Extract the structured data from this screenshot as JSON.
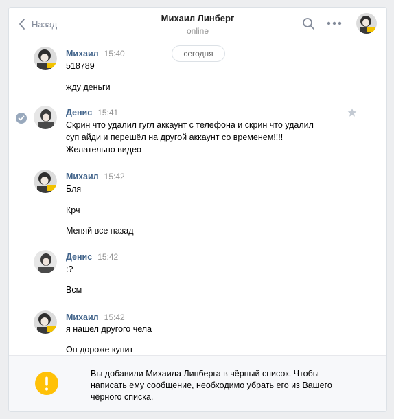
{
  "header": {
    "back_label": "Назад",
    "contact_name": "Михаил Линберг",
    "contact_status": "online"
  },
  "chat": {
    "date_label": "сегодня",
    "messages": [
      {
        "author": "Михаил",
        "time": "15:40",
        "lines": [
          "518789",
          "жду деньги"
        ]
      },
      {
        "author": "Денис",
        "time": "15:41",
        "lines": [
          "Скрин что удалил гугл аккаунт с телефона и скрин что удалил",
          "суп айди и перешёл на другой аккаунт со временем!!!!",
          "Желательно видео"
        ]
      },
      {
        "author": "Михаил",
        "time": "15:42",
        "lines": [
          "Бля",
          "Крч",
          "Меняй все назад"
        ]
      },
      {
        "author": "Денис",
        "time": "15:42",
        "lines": [
          ":?",
          "Всм"
        ]
      },
      {
        "author": "Михаил",
        "time": "15:42",
        "lines": [
          "я нашел другого чела",
          "Он дороже купит"
        ]
      }
    ]
  },
  "footer": {
    "notice_line1": "Вы добавили Михаила Линберга в чёрный список. Чтобы",
    "notice_line2": "написать ему сообщение, необходимо убрать его из Вашего",
    "notice_line3": "чёрного списка."
  },
  "colors": {
    "link": "#42648b",
    "warning": "#ffc107",
    "muted": "#939393"
  }
}
